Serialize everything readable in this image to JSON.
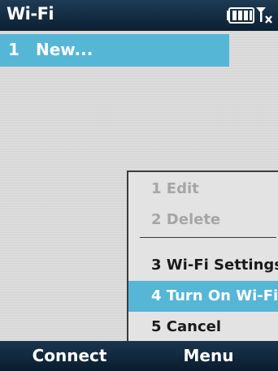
{
  "title": "Wi-Fi",
  "status_icons": [
    "battery-icon",
    "signal-icon"
  ],
  "list": [
    {
      "number": "1",
      "label": "New...",
      "selected": true
    }
  ],
  "menu": {
    "items": [
      {
        "label": "1 Edit",
        "enabled": false
      },
      {
        "label": "2 Delete",
        "enabled": false
      },
      {
        "label": "3 Wi-Fi Settings",
        "enabled": true
      },
      {
        "label": "4 Turn On Wi-Fi",
        "enabled": true,
        "selected": true
      },
      {
        "label": "5 Cancel",
        "enabled": true
      }
    ]
  },
  "softkeys": {
    "left": "Connect",
    "right": "Menu"
  },
  "colors": {
    "highlight": "#56b6d6",
    "bar": "#0b2033",
    "background": "#dadada",
    "disabled_text": "#a6a6a6"
  }
}
